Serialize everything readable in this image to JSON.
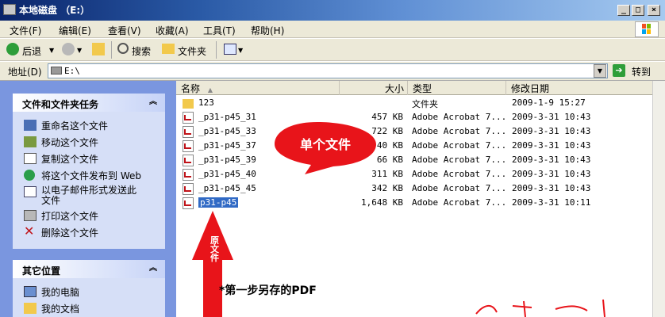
{
  "window": {
    "title": "本地磁盘 （E:）",
    "minimize": "_",
    "maximize": "□",
    "close": "×"
  },
  "menu": [
    "文件(F)",
    "编辑(E)",
    "查看(V)",
    "收藏(A)",
    "工具(T)",
    "帮助(H)"
  ],
  "toolbar": {
    "back": "后退",
    "search": "搜索",
    "folders": "文件夹"
  },
  "address": {
    "label": "地址(D)",
    "value": "E:\\",
    "go": "转到"
  },
  "panels": {
    "file_tasks": {
      "title": "文件和文件夹任务",
      "items": [
        "重命名这个文件",
        "移动这个文件",
        "复制这个文件",
        "将这个文件发布到 Web",
        "以电子邮件形式发送此文件",
        "打印这个文件",
        "删除这个文件"
      ]
    },
    "other_places": {
      "title": "其它位置",
      "items": [
        "我的电脑",
        "我的文档"
      ]
    }
  },
  "columns": [
    "名称",
    "大小",
    "类型",
    "修改日期"
  ],
  "files": [
    {
      "name": "123",
      "size": "",
      "type": "文件夹",
      "date": "2009-1-9 15:27",
      "kind": "folder"
    },
    {
      "name": "_p31-p45_31",
      "size": "457 KB",
      "type": "Adobe Acrobat 7...",
      "date": "2009-3-31 10:43",
      "kind": "pdf"
    },
    {
      "name": "_p31-p45_33",
      "size": "722 KB",
      "type": "Adobe Acrobat 7...",
      "date": "2009-3-31 10:43",
      "kind": "pdf"
    },
    {
      "name": "_p31-p45_37",
      "size": "40 KB",
      "type": "Adobe Acrobat 7...",
      "date": "2009-3-31 10:43",
      "kind": "pdf"
    },
    {
      "name": "_p31-p45_39",
      "size": "66 KB",
      "type": "Adobe Acrobat 7...",
      "date": "2009-3-31 10:43",
      "kind": "pdf"
    },
    {
      "name": "_p31-p45_40",
      "size": "311 KB",
      "type": "Adobe Acrobat 7...",
      "date": "2009-3-31 10:43",
      "kind": "pdf"
    },
    {
      "name": "_p31-p45_45",
      "size": "342 KB",
      "type": "Adobe Acrobat 7...",
      "date": "2009-3-31 10:43",
      "kind": "pdf"
    },
    {
      "name": "p31-p45",
      "size": "1,648 KB",
      "type": "Adobe Acrobat 7...",
      "date": "2009-3-31 10:11",
      "kind": "pdf",
      "selected": true
    }
  ],
  "annotations": {
    "bubble": "单个文件",
    "arrow": "原文件",
    "note": "*第一步另存的PDF"
  },
  "colors": {
    "title_gradient_start": "#0a246a",
    "task_pane": "#7a96df",
    "selection": "#316ac5",
    "annotation_red": "#e8141a"
  }
}
